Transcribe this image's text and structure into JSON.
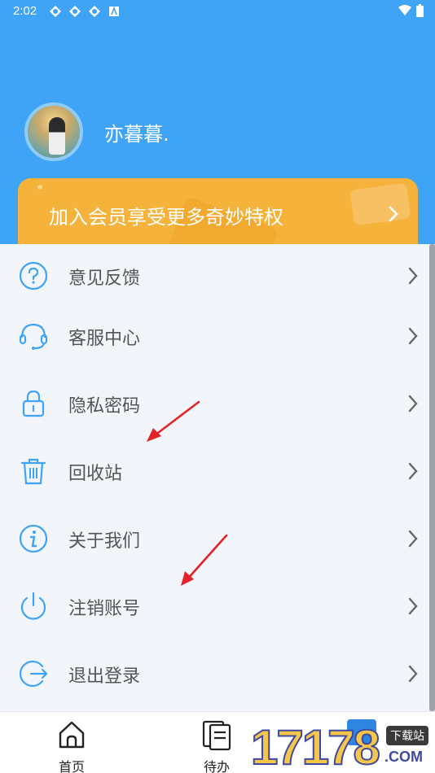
{
  "status_bar": {
    "time": "2:02"
  },
  "profile": {
    "username": "亦暮暮."
  },
  "vip_banner": {
    "text": "加入会员享受更多奇妙特权"
  },
  "menu": {
    "items": [
      {
        "label": "意见反馈",
        "icon": "question-circle-icon"
      },
      {
        "label": "客服中心",
        "icon": "headset-icon"
      },
      {
        "label": "隐私密码",
        "icon": "lock-icon"
      },
      {
        "label": "回收站",
        "icon": "trash-icon"
      },
      {
        "label": "关于我们",
        "icon": "info-circle-icon"
      },
      {
        "label": "注销账号",
        "icon": "power-icon"
      },
      {
        "label": "退出登录",
        "icon": "logout-icon"
      }
    ]
  },
  "tabs": [
    {
      "label": "首页",
      "icon": "home-icon"
    },
    {
      "label": "待办",
      "icon": "todo-icon"
    }
  ],
  "watermark": {
    "digits": "17178",
    "tag": "下载站",
    "domain": ".COM"
  },
  "colors": {
    "primary": "#3fa4f5",
    "vip": "#f5b33b",
    "annotation": "#e0242a"
  }
}
